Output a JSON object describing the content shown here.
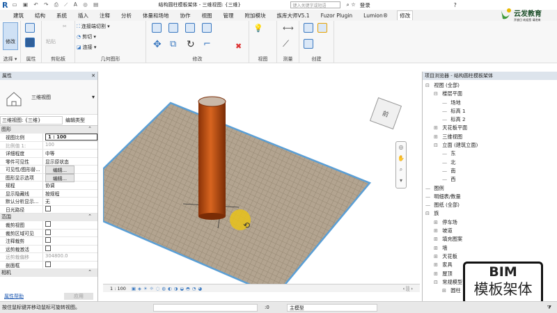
{
  "titlebar": {
    "title": "结构圆柱模板架体 - 三维视图: {三维}",
    "search_placeholder": "键入关键字或短语",
    "login": "登录"
  },
  "logo": {
    "name": "云发教育",
    "tagline": "开放日 欢迎您 请进来"
  },
  "tabs": [
    "建筑",
    "结构",
    "系统",
    "插入",
    "注释",
    "分析",
    "体量和场地",
    "协作",
    "视图",
    "管理",
    "附加模块",
    "族库大师V5.1",
    "Fuzor Plugin",
    "Lumion®",
    "修改"
  ],
  "active_tab": "修改",
  "ribbon": {
    "groups": [
      "选择 ▾",
      "属性",
      "剪贴板",
      "几何图形",
      "修改",
      "视图",
      "测量",
      "创建"
    ],
    "modify_label": "修改",
    "paste_label": "粘贴",
    "geo_items": [
      "连接端切割 ▾",
      "剪切 ▾",
      "连接 ▾"
    ]
  },
  "properties": {
    "title": "属性",
    "type_name": "三维视图",
    "selector": "三维视图: {三维}",
    "edit_type": "编辑类型",
    "sections": [
      {
        "name": "图形",
        "rows": [
          {
            "k": "视图比例",
            "v": "1 : 100",
            "kind": "input"
          },
          {
            "k": "比例值 1:",
            "v": "100",
            "kind": "grey"
          },
          {
            "k": "详细程度",
            "v": "中等"
          },
          {
            "k": "零件可见性",
            "v": "显示原状态"
          },
          {
            "k": "可见性/图形替...",
            "v": "编辑...",
            "kind": "button"
          },
          {
            "k": "图形显示选项",
            "v": "编辑...",
            "kind": "button"
          },
          {
            "k": "规程",
            "v": "协调"
          },
          {
            "k": "显示隐藏线",
            "v": "按规程"
          },
          {
            "k": "默认分析显示...",
            "v": "无"
          },
          {
            "k": "日光路径",
            "v": "",
            "kind": "check"
          }
        ]
      },
      {
        "name": "范围",
        "rows": [
          {
            "k": "裁剪视图",
            "v": "",
            "kind": "check"
          },
          {
            "k": "裁剪区域可见",
            "v": "",
            "kind": "check"
          },
          {
            "k": "注释裁剪",
            "v": "",
            "kind": "check"
          },
          {
            "k": "远剪裁激活",
            "v": "",
            "kind": "check"
          },
          {
            "k": "远剪裁偏移",
            "v": "304800.0",
            "kind": "grey"
          },
          {
            "k": "剖面框",
            "v": "",
            "kind": "check"
          }
        ]
      },
      {
        "name": "相机",
        "rows": []
      }
    ],
    "help": "属性帮助",
    "apply": "应用"
  },
  "browser": {
    "title": "项目浏览器 - 结构圆柱模板架体",
    "items": [
      {
        "t": "视图 (全部)",
        "d": 0,
        "s": "⊟"
      },
      {
        "t": "楼层平面",
        "d": 1,
        "s": "⊟"
      },
      {
        "t": "场地",
        "d": 2,
        "s": ""
      },
      {
        "t": "标高 1",
        "d": 2,
        "s": ""
      },
      {
        "t": "标高 2",
        "d": 2,
        "s": ""
      },
      {
        "t": "天花板平面",
        "d": 1,
        "s": "⊞"
      },
      {
        "t": "三维视图",
        "d": 1,
        "s": "⊞"
      },
      {
        "t": "立面 (建筑立面)",
        "d": 1,
        "s": "⊟"
      },
      {
        "t": "东",
        "d": 2,
        "s": ""
      },
      {
        "t": "北",
        "d": 2,
        "s": ""
      },
      {
        "t": "南",
        "d": 2,
        "s": ""
      },
      {
        "t": "西",
        "d": 2,
        "s": ""
      },
      {
        "t": "图例",
        "d": 0,
        "s": ""
      },
      {
        "t": "明细表/数量",
        "d": 0,
        "s": ""
      },
      {
        "t": "图纸 (全部)",
        "d": 0,
        "s": ""
      },
      {
        "t": "族",
        "d": 0,
        "s": "⊟"
      },
      {
        "t": "停车场",
        "d": 1,
        "s": "⊞"
      },
      {
        "t": "坡道",
        "d": 1,
        "s": "⊞"
      },
      {
        "t": "填充图案",
        "d": 1,
        "s": "⊞"
      },
      {
        "t": "墙",
        "d": 1,
        "s": "⊞"
      },
      {
        "t": "天花板",
        "d": 1,
        "s": "⊞"
      },
      {
        "t": "家具",
        "d": 1,
        "s": "⊞"
      },
      {
        "t": "屋顶",
        "d": 1,
        "s": "⊞"
      },
      {
        "t": "常规模型",
        "d": 1,
        "s": "⊟"
      },
      {
        "t": "圆柱",
        "d": 2,
        "s": "⊞"
      }
    ]
  },
  "viewcube": {
    "face": "前"
  },
  "viewbar": {
    "scale": "1 : 100"
  },
  "status": {
    "hint": "按住鼠标键并移动鼠标可旋转视图。",
    "zero": ":0",
    "model": "主模型"
  },
  "badge": {
    "line1": "BIM",
    "line2": "模板架体"
  },
  "colors": {
    "column": "#c8561a",
    "floor": "#b5a590",
    "highlight": "#e8c21a",
    "accent": "#3a78c0"
  }
}
